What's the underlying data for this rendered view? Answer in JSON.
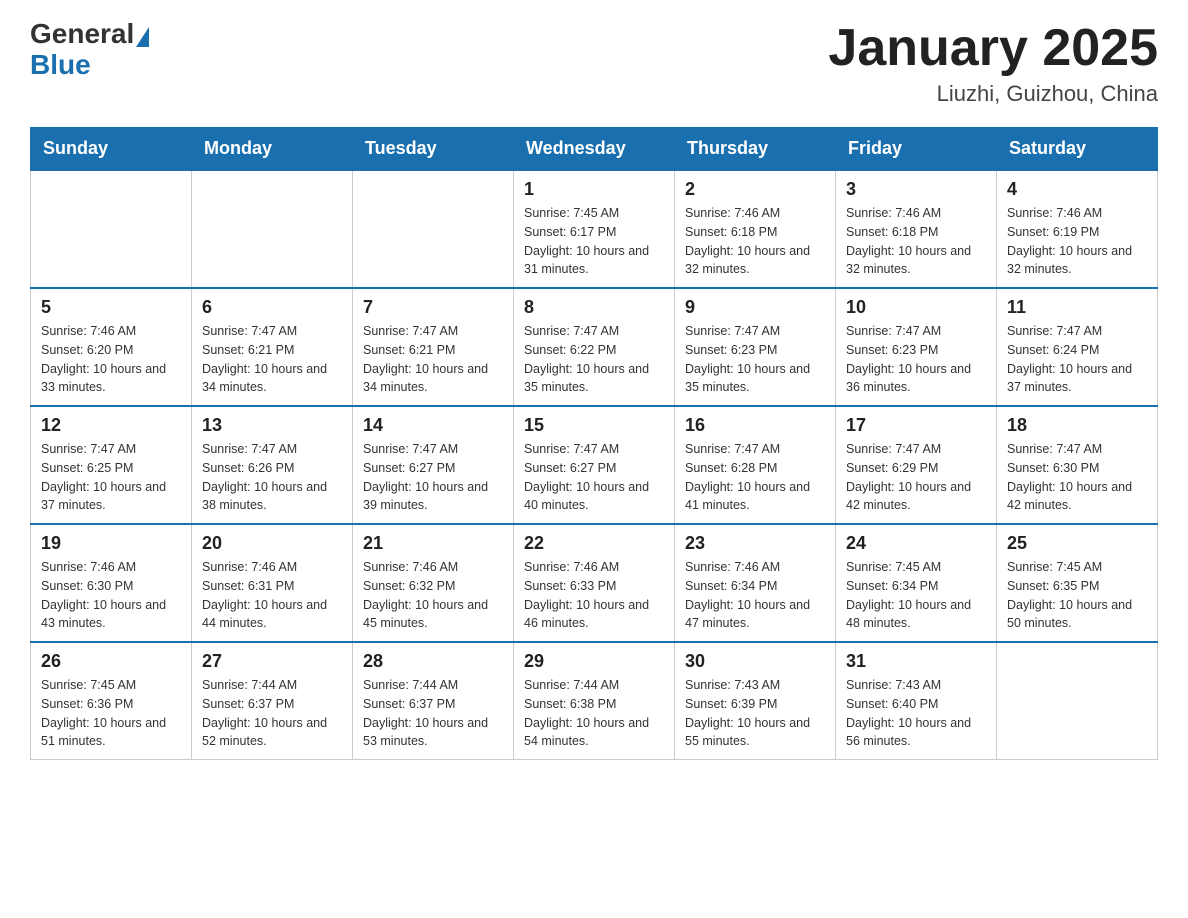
{
  "header": {
    "logo_general": "General",
    "logo_blue": "Blue",
    "title": "January 2025",
    "subtitle": "Liuzhi, Guizhou, China"
  },
  "days_of_week": [
    "Sunday",
    "Monday",
    "Tuesday",
    "Wednesday",
    "Thursday",
    "Friday",
    "Saturday"
  ],
  "weeks": [
    [
      {
        "day": "",
        "info": ""
      },
      {
        "day": "",
        "info": ""
      },
      {
        "day": "",
        "info": ""
      },
      {
        "day": "1",
        "info": "Sunrise: 7:45 AM\nSunset: 6:17 PM\nDaylight: 10 hours\nand 31 minutes."
      },
      {
        "day": "2",
        "info": "Sunrise: 7:46 AM\nSunset: 6:18 PM\nDaylight: 10 hours\nand 32 minutes."
      },
      {
        "day": "3",
        "info": "Sunrise: 7:46 AM\nSunset: 6:18 PM\nDaylight: 10 hours\nand 32 minutes."
      },
      {
        "day": "4",
        "info": "Sunrise: 7:46 AM\nSunset: 6:19 PM\nDaylight: 10 hours\nand 32 minutes."
      }
    ],
    [
      {
        "day": "5",
        "info": "Sunrise: 7:46 AM\nSunset: 6:20 PM\nDaylight: 10 hours\nand 33 minutes."
      },
      {
        "day": "6",
        "info": "Sunrise: 7:47 AM\nSunset: 6:21 PM\nDaylight: 10 hours\nand 34 minutes."
      },
      {
        "day": "7",
        "info": "Sunrise: 7:47 AM\nSunset: 6:21 PM\nDaylight: 10 hours\nand 34 minutes."
      },
      {
        "day": "8",
        "info": "Sunrise: 7:47 AM\nSunset: 6:22 PM\nDaylight: 10 hours\nand 35 minutes."
      },
      {
        "day": "9",
        "info": "Sunrise: 7:47 AM\nSunset: 6:23 PM\nDaylight: 10 hours\nand 35 minutes."
      },
      {
        "day": "10",
        "info": "Sunrise: 7:47 AM\nSunset: 6:23 PM\nDaylight: 10 hours\nand 36 minutes."
      },
      {
        "day": "11",
        "info": "Sunrise: 7:47 AM\nSunset: 6:24 PM\nDaylight: 10 hours\nand 37 minutes."
      }
    ],
    [
      {
        "day": "12",
        "info": "Sunrise: 7:47 AM\nSunset: 6:25 PM\nDaylight: 10 hours\nand 37 minutes."
      },
      {
        "day": "13",
        "info": "Sunrise: 7:47 AM\nSunset: 6:26 PM\nDaylight: 10 hours\nand 38 minutes."
      },
      {
        "day": "14",
        "info": "Sunrise: 7:47 AM\nSunset: 6:27 PM\nDaylight: 10 hours\nand 39 minutes."
      },
      {
        "day": "15",
        "info": "Sunrise: 7:47 AM\nSunset: 6:27 PM\nDaylight: 10 hours\nand 40 minutes."
      },
      {
        "day": "16",
        "info": "Sunrise: 7:47 AM\nSunset: 6:28 PM\nDaylight: 10 hours\nand 41 minutes."
      },
      {
        "day": "17",
        "info": "Sunrise: 7:47 AM\nSunset: 6:29 PM\nDaylight: 10 hours\nand 42 minutes."
      },
      {
        "day": "18",
        "info": "Sunrise: 7:47 AM\nSunset: 6:30 PM\nDaylight: 10 hours\nand 42 minutes."
      }
    ],
    [
      {
        "day": "19",
        "info": "Sunrise: 7:46 AM\nSunset: 6:30 PM\nDaylight: 10 hours\nand 43 minutes."
      },
      {
        "day": "20",
        "info": "Sunrise: 7:46 AM\nSunset: 6:31 PM\nDaylight: 10 hours\nand 44 minutes."
      },
      {
        "day": "21",
        "info": "Sunrise: 7:46 AM\nSunset: 6:32 PM\nDaylight: 10 hours\nand 45 minutes."
      },
      {
        "day": "22",
        "info": "Sunrise: 7:46 AM\nSunset: 6:33 PM\nDaylight: 10 hours\nand 46 minutes."
      },
      {
        "day": "23",
        "info": "Sunrise: 7:46 AM\nSunset: 6:34 PM\nDaylight: 10 hours\nand 47 minutes."
      },
      {
        "day": "24",
        "info": "Sunrise: 7:45 AM\nSunset: 6:34 PM\nDaylight: 10 hours\nand 48 minutes."
      },
      {
        "day": "25",
        "info": "Sunrise: 7:45 AM\nSunset: 6:35 PM\nDaylight: 10 hours\nand 50 minutes."
      }
    ],
    [
      {
        "day": "26",
        "info": "Sunrise: 7:45 AM\nSunset: 6:36 PM\nDaylight: 10 hours\nand 51 minutes."
      },
      {
        "day": "27",
        "info": "Sunrise: 7:44 AM\nSunset: 6:37 PM\nDaylight: 10 hours\nand 52 minutes."
      },
      {
        "day": "28",
        "info": "Sunrise: 7:44 AM\nSunset: 6:37 PM\nDaylight: 10 hours\nand 53 minutes."
      },
      {
        "day": "29",
        "info": "Sunrise: 7:44 AM\nSunset: 6:38 PM\nDaylight: 10 hours\nand 54 minutes."
      },
      {
        "day": "30",
        "info": "Sunrise: 7:43 AM\nSunset: 6:39 PM\nDaylight: 10 hours\nand 55 minutes."
      },
      {
        "day": "31",
        "info": "Sunrise: 7:43 AM\nSunset: 6:40 PM\nDaylight: 10 hours\nand 56 minutes."
      },
      {
        "day": "",
        "info": ""
      }
    ]
  ]
}
